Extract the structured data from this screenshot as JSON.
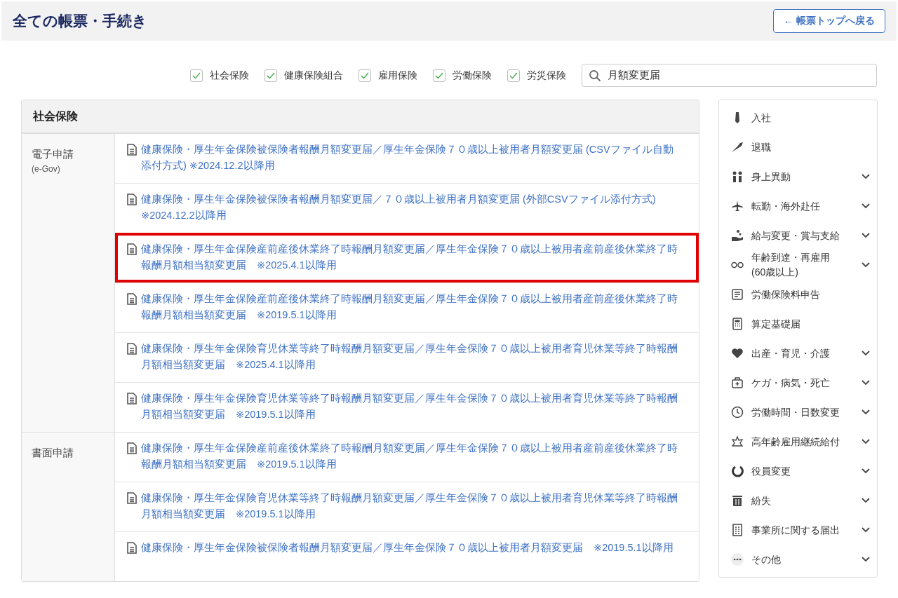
{
  "header": {
    "title": "全ての帳票・手続き",
    "back_button": "← 帳票トップへ戻る"
  },
  "filters": [
    {
      "label": "社会保険",
      "checked": true
    },
    {
      "label": "健康保険組合",
      "checked": true
    },
    {
      "label": "雇用保険",
      "checked": true
    },
    {
      "label": "労働保険",
      "checked": true
    },
    {
      "label": "労災保険",
      "checked": true
    }
  ],
  "search": {
    "value": "月額変更届"
  },
  "panel": {
    "title": "社会保険",
    "groups": [
      {
        "label": "電子申請",
        "sublabel": "(e-Gov)",
        "forms": [
          {
            "text": "健康保険・厚生年金保険被保険者報酬月額変更届／厚生年金保険７０歳以上被用者月額変更届 (CSVファイル自動添付方式) ※2024.12.2以降用",
            "highlighted": false
          },
          {
            "text": "健康保険・厚生年金保険被保険者報酬月額変更届／７０歳以上被用者月額変更届 (外部CSVファイル添付方式) ※2024.12.2以降用",
            "highlighted": false
          },
          {
            "text": "健康保険・厚生年金保険産前産後休業終了時報酬月額変更届／厚生年金保険７０歳以上被用者産前産後休業終了時報酬月額相当額変更届　※2025.4.1以降用",
            "highlighted": true
          },
          {
            "text": "健康保険・厚生年金保険産前産後休業終了時報酬月額変更届／厚生年金保険７０歳以上被用者産前産後休業終了時報酬月額相当額変更届　※2019.5.1以降用",
            "highlighted": false
          },
          {
            "text": "健康保険・厚生年金保険育児休業等終了時報酬月額変更届／厚生年金保険７０歳以上被用者育児休業等終了時報酬月額相当額変更届　※2025.4.1以降用",
            "highlighted": false
          },
          {
            "text": "健康保険・厚生年金保険育児休業等終了時報酬月額変更届／厚生年金保険７０歳以上被用者育児休業等終了時報酬月額相当額変更届　※2019.5.1以降用",
            "highlighted": false
          }
        ]
      },
      {
        "label": "書面申請",
        "forms": [
          {
            "text": "健康保険・厚生年金保険産前産後休業終了時報酬月額変更届／厚生年金保険７０歳以上被用者産前産後休業終了時報酬月額相当額変更届　※2019.5.1以降用",
            "highlighted": false
          },
          {
            "text": "健康保険・厚生年金保険育児休業等終了時報酬月額変更届／厚生年金保険７０歳以上被用者育児休業等終了時報酬月額相当額変更届　※2019.5.1以降用",
            "highlighted": false
          },
          {
            "text": "健康保険・厚生年金保険被保険者報酬月額変更届／厚生年金保険７０歳以上被用者月額変更届　※2019.5.1以降用",
            "highlighted": false
          }
        ]
      }
    ]
  },
  "categories": [
    {
      "label": "入社",
      "expandable": false
    },
    {
      "label": "退職",
      "expandable": false
    },
    {
      "label": "身上異動",
      "expandable": true
    },
    {
      "label": "転勤・海外赴任",
      "expandable": true
    },
    {
      "label": "給与変更・賞与支給",
      "expandable": true
    },
    {
      "label": "年齢到達・再雇用\n(60歳以上)",
      "expandable": true
    },
    {
      "label": "労働保険料申告",
      "expandable": false
    },
    {
      "label": "算定基礎届",
      "expandable": false
    },
    {
      "label": "出産・育児・介護",
      "expandable": true
    },
    {
      "label": "ケガ・病気・死亡",
      "expandable": true
    },
    {
      "label": "労働時間・日数変更",
      "expandable": true
    },
    {
      "label": "高年齢雇用継続給付",
      "expandable": true
    },
    {
      "label": "役員変更",
      "expandable": true
    },
    {
      "label": "紛失",
      "expandable": true
    },
    {
      "label": "事業所に関する届出",
      "expandable": true
    },
    {
      "label": "その他",
      "expandable": true
    }
  ]
}
